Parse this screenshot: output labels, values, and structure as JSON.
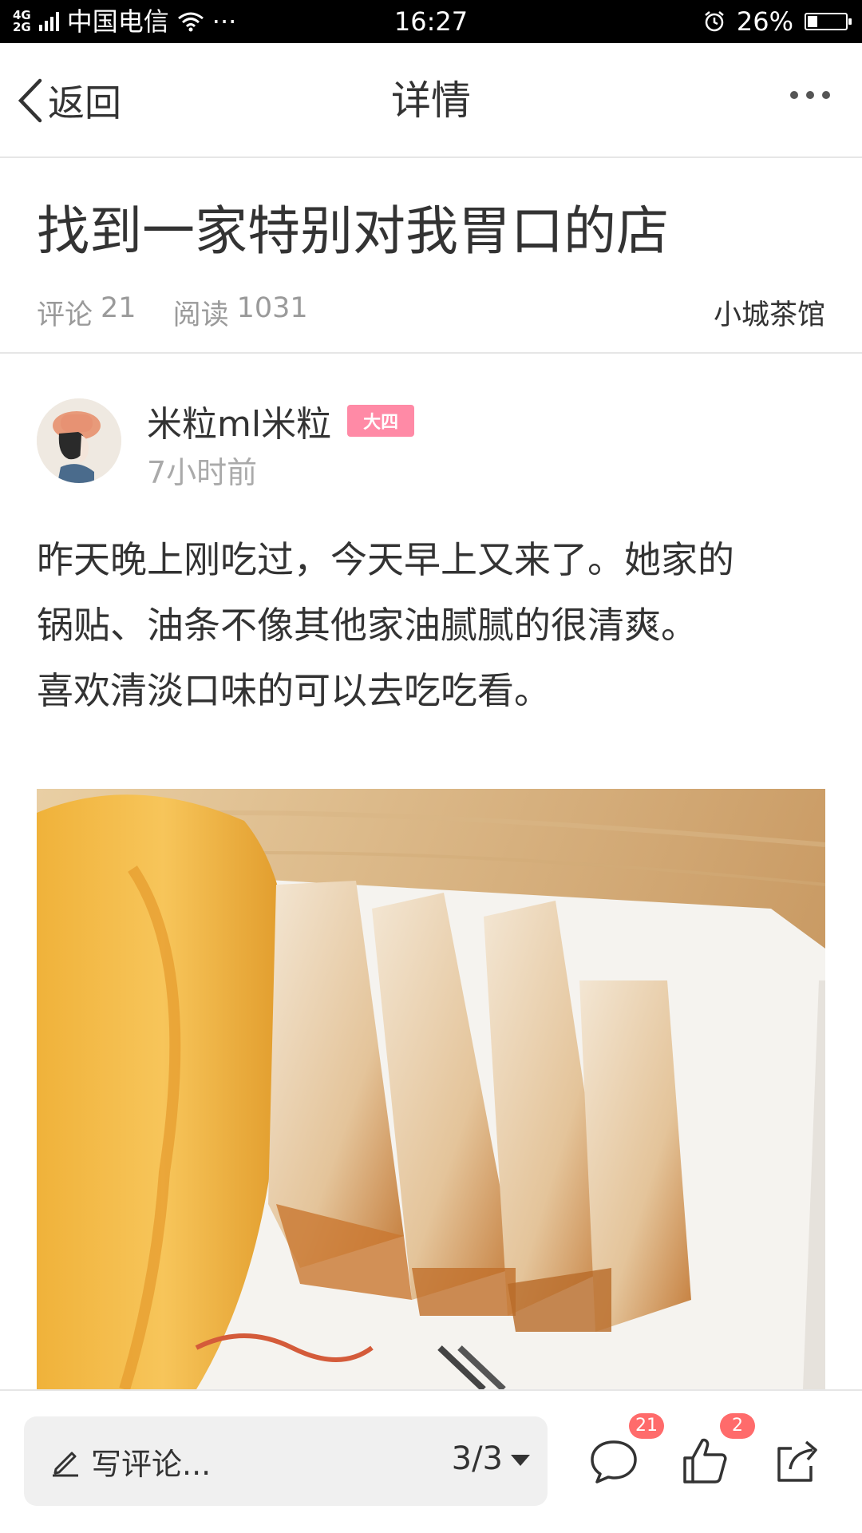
{
  "status_bar": {
    "network": [
      "4G",
      "2G"
    ],
    "carrier": "中国电信",
    "more": "···",
    "time": "16:27",
    "battery_percent": "26%",
    "battery_level": 0.26
  },
  "nav": {
    "back_label": "返回",
    "title": "详情"
  },
  "article": {
    "title": "找到一家特别对我胃口的店",
    "comments_label": "评论",
    "comments_count": "21",
    "reads_label": "阅读",
    "reads_count": "1031",
    "forum": "小城茶馆"
  },
  "author": {
    "name": "米粒ml米粒",
    "badge": "大四",
    "time": "7小时前"
  },
  "post": {
    "lines": [
      "昨天晚上刚吃过，今天早上又来了。她家的",
      "锅贴、油条不像其他家油腻腻的很清爽。",
      "喜欢清淡口味的可以去吃吃看。"
    ]
  },
  "bottom": {
    "comment_placeholder": "写评论...",
    "page": "3/3",
    "comment_count": "21",
    "like_count": "2"
  },
  "colors": {
    "badge": "#ff8aa6",
    "count_badge": "#ff6b6b",
    "muted_text": "#9a9a9a"
  }
}
